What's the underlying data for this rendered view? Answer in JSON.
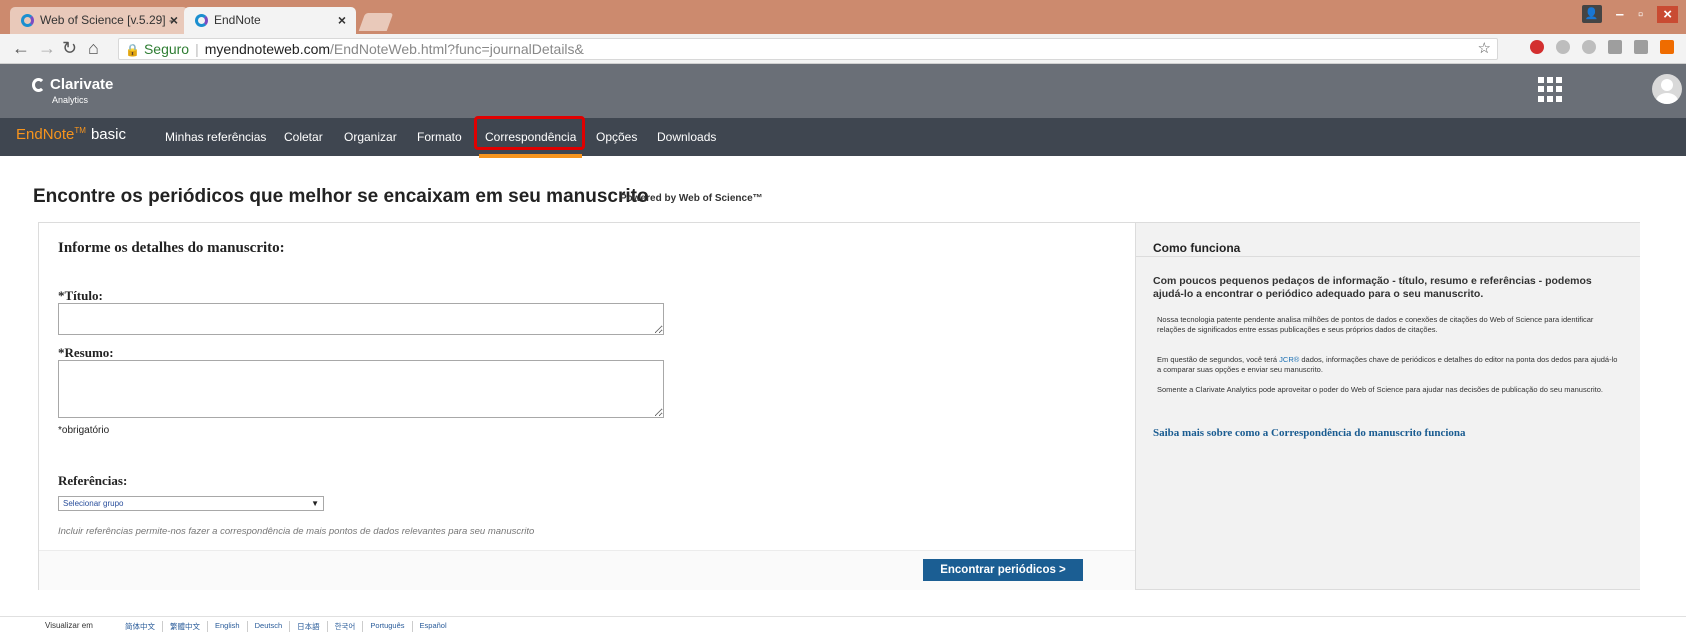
{
  "browser": {
    "tabs": [
      {
        "title": "Web of Science [v.5.29] - ",
        "close": "×"
      },
      {
        "title": "EndNote",
        "close": "×"
      }
    ],
    "secure_label": "Seguro",
    "url_host": "myendnoteweb.com",
    "url_path": "/EndNoteWeb.html?func=journalDetails&"
  },
  "header": {
    "logo_name": "Clarivate",
    "logo_sub": "Analytics"
  },
  "nav": {
    "brand": "EndNote",
    "brand_tm": "TM",
    "brand_basic": "basic",
    "items": [
      "Minhas referências",
      "Coletar",
      "Organizar",
      "Formato",
      "Correspondência",
      "Opções",
      "Downloads"
    ],
    "active_item": "Correspondência"
  },
  "page": {
    "title": "Encontre os periódicos que melhor se encaixam em seu manuscrito",
    "powered_by": "Powered by Web of Science™"
  },
  "form": {
    "heading": "Informe os detalhes do manuscrito:",
    "title_label": "*Título:",
    "abstract_label": "*Resumo:",
    "required_note": "*obrigatório",
    "references_label": "Referências:",
    "group_select": "Selecionar grupo",
    "references_hint": "Incluir referências permite-nos fazer a correspondência de mais pontos de dados relevantes para seu manuscrito",
    "find_button": "Encontrar periódicos >"
  },
  "how_it_works": {
    "heading": "Como funciona",
    "lead": "Com poucos pequenos pedaços de informação - título, resumo e referências - podemos ajudá-lo a encontrar o periódico adequado para o seu manuscrito.",
    "para1": "Nossa tecnologia patente pendente analisa milhões de pontos de dados e conexões de citações do Web of Science para identificar relações de significados entre essas publicações e seus próprios dados de citações.",
    "para2_before": "Em questão de segundos, você terá ",
    "para2_link": "JCR®",
    "para2_after": " dados, informações chave de periódicos e detalhes do editor na ponta dos dedos para ajudá-lo a comparar suas opções e enviar seu manuscrito.",
    "para3": "Somente a Clarivate Analytics pode aproveitar o poder do Web of Science para ajudar nas decisões de publicação do seu manuscrito.",
    "learn_more": "Saiba mais sobre como a Correspondência do manuscrito funciona"
  },
  "footer": {
    "view_in": "Visualizar em",
    "languages": [
      "简体中文",
      "繁體中文",
      "English",
      "Deutsch",
      "日本語",
      "한국어",
      "Português",
      "Español"
    ]
  }
}
